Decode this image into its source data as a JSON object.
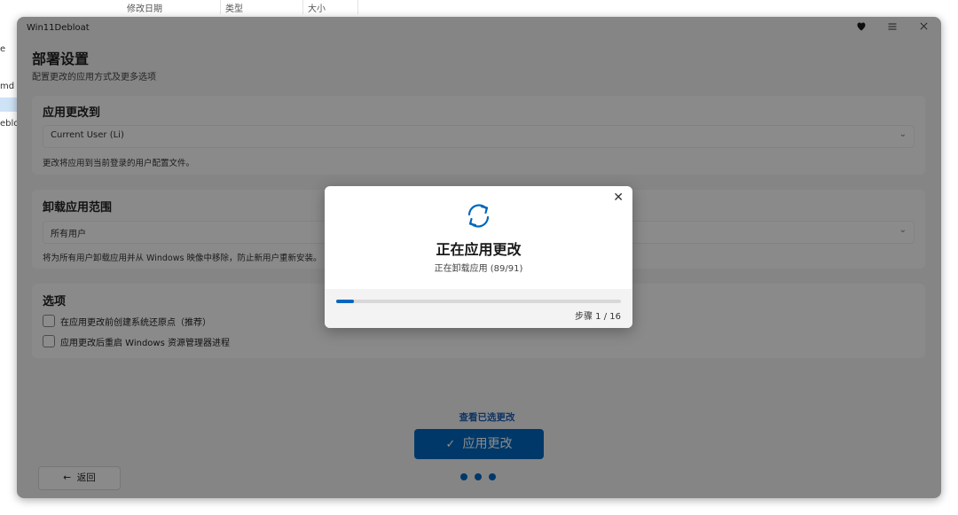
{
  "background_window": {
    "columns": [
      "修改日期",
      "类型",
      "大小"
    ],
    "left_items": [
      "e",
      "md",
      "ebloat"
    ]
  },
  "app": {
    "title": "Win11Debloat",
    "icons": [
      "heart-icon",
      "menu-icon",
      "close-icon"
    ],
    "page_title": "部署设置",
    "page_subtitle": "配置更改的应用方式及更多选项",
    "apply_to": {
      "title": "应用更改到",
      "selected": "Current User (Li)",
      "hint": "更改将应用到当前登录的用户配置文件。"
    },
    "uninstall_scope": {
      "title": "卸载应用范围",
      "selected": "所有用户",
      "hint": "将为所有用户卸载应用并从 Windows 映像中移除，防止新用户重新安装。"
    },
    "options": {
      "title": "选项",
      "items": [
        {
          "label": "在应用更改前创建系统还原点（推荐）",
          "checked": false
        },
        {
          "label": "应用更改后重启 Windows 资源管理器进程",
          "checked": false
        }
      ]
    },
    "view_changes_link": "查看已选更改",
    "apply_button": "应用更改",
    "back_button": "返回",
    "back_arrow": "←",
    "check_glyph": "✓",
    "chevron_glyph": "⌄",
    "page_dots": 3
  },
  "dialog": {
    "title": "正在应用更改",
    "subtitle": "正在卸载应用 (89/91)",
    "progress_fraction": 0.0625,
    "step_text": "步骤 1 / 16",
    "icon": "sync-icon",
    "close_glyph": "✕"
  },
  "colors": {
    "accent": "#0067c0",
    "overlay": "rgba(0,0,0,0.45)"
  }
}
